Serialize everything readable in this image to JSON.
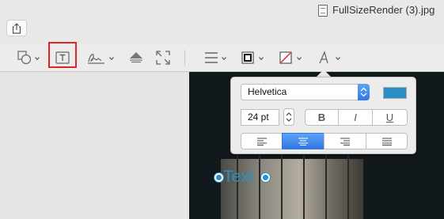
{
  "window": {
    "title": "FullSizeRender (3).jpg"
  },
  "toolbar": {
    "share_icon": "share-icon",
    "tools": [
      {
        "name": "shapes-tool",
        "icon": "shapes-icon"
      },
      {
        "name": "text-tool",
        "icon": "text-box-icon",
        "selected": true
      },
      {
        "name": "sign-tool",
        "icon": "signature-icon"
      },
      {
        "name": "adjust-color-tool",
        "icon": "adjust-color-icon"
      },
      {
        "name": "adjust-size-tool",
        "icon": "resize-icon"
      },
      {
        "name": "shape-style-tool",
        "icon": "line-style-icon"
      },
      {
        "name": "border-color-tool",
        "icon": "border-color-icon"
      },
      {
        "name": "fill-color-tool",
        "icon": "fill-color-icon"
      },
      {
        "name": "text-style-tool",
        "icon": "text-style-icon"
      }
    ],
    "selection_highlight_color": "#e0242a"
  },
  "text_style_popover": {
    "font_family": "Helvetica",
    "font_size": "24 pt",
    "color": "#2a8fc7",
    "style_buttons": {
      "bold": "B",
      "italic": "I",
      "underline": "U"
    },
    "alignment_options": [
      "left",
      "center",
      "right",
      "justify"
    ],
    "selected_alignment": "center"
  },
  "canvas": {
    "annotation_text": "Text",
    "annotation_color": "#2a8fc7"
  }
}
